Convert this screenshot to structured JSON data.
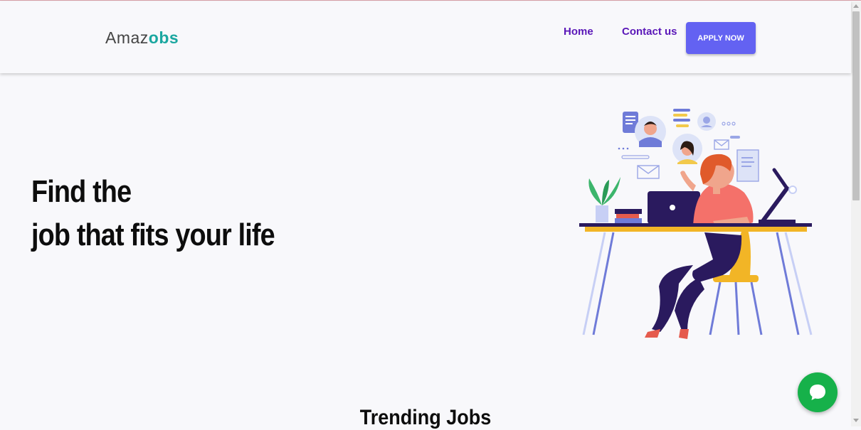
{
  "header": {
    "logo_part1": "Amaz",
    "logo_part2": "obs",
    "nav": {
      "home": "Home",
      "contact": "Contact us"
    },
    "apply_label": "APPLY NOW"
  },
  "hero": {
    "title_line1": "Find the",
    "title_line2": "job that fits your life"
  },
  "trending": {
    "title": "Trending Jobs"
  },
  "colors": {
    "brand_teal": "#1ba7a0",
    "nav_purple": "#5a17b8",
    "button_blue": "#6362f2",
    "chat_green": "#16b14a"
  },
  "icons": {
    "chat": "chat-bubble-icon",
    "illustration": "woman-at-desk-illustration"
  }
}
